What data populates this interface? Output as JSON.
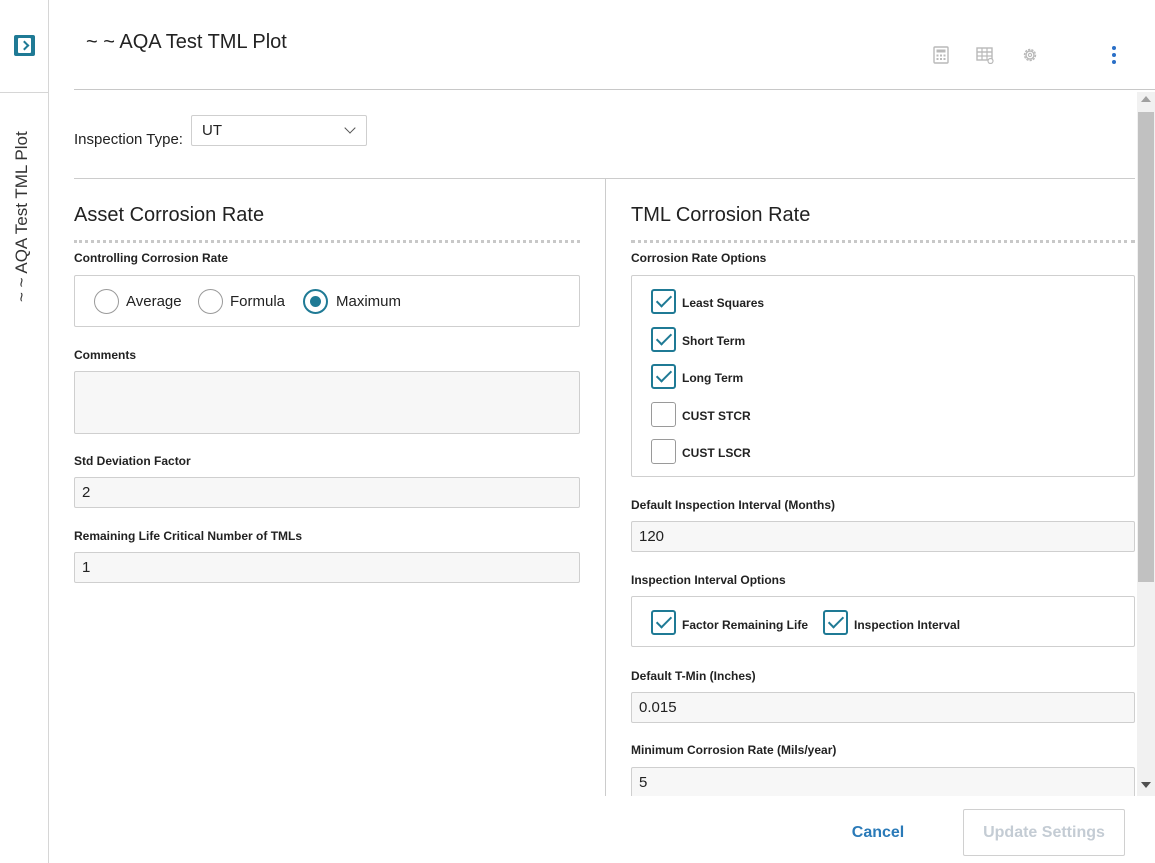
{
  "rail": {
    "title": "~ ~ AQA Test TML Plot"
  },
  "header": {
    "title": "~ ~ AQA Test TML Plot",
    "icons": [
      "calculator-icon",
      "table-settings-icon",
      "gear-icon",
      "more-vertical-icon"
    ]
  },
  "inspection_type": {
    "label": "Inspection Type:",
    "value": "UT"
  },
  "asset": {
    "title": "Asset Corrosion Rate",
    "controlling_label": "Controlling Corrosion Rate",
    "radios": [
      {
        "label": "Average",
        "selected": false
      },
      {
        "label": "Formula",
        "selected": false
      },
      {
        "label": "Maximum",
        "selected": true
      }
    ],
    "comments_label": "Comments",
    "comments_value": "",
    "std_dev_label": "Std Deviation Factor",
    "std_dev_value": "2",
    "remaining_life_label": "Remaining Life Critical Number of TMLs",
    "remaining_life_value": "1"
  },
  "tml": {
    "title": "TML Corrosion Rate",
    "options_label": "Corrosion Rate Options",
    "options": [
      {
        "label": "Least Squares",
        "checked": true
      },
      {
        "label": "Short Term",
        "checked": true
      },
      {
        "label": "Long Term",
        "checked": true
      },
      {
        "label": "CUST STCR",
        "checked": false
      },
      {
        "label": "CUST LSCR",
        "checked": false
      }
    ],
    "default_interval_label": "Default Inspection Interval (Months)",
    "default_interval_value": "120",
    "interval_options_label": "Inspection Interval Options",
    "interval_options": [
      {
        "label": "Factor Remaining Life",
        "checked": true
      },
      {
        "label": "Inspection Interval",
        "checked": true
      }
    ],
    "tmin_label": "Default T-Min (Inches)",
    "tmin_value": "0.015",
    "min_rate_label": "Minimum Corrosion Rate (Mils/year)",
    "min_rate_value": "5"
  },
  "footer": {
    "cancel_label": "Cancel",
    "update_label": "Update Settings"
  },
  "colors": {
    "accent": "#1f7a95",
    "link": "#2a7ab8",
    "disabled_text": "#c4ccd4",
    "border": "#cfcfcf"
  }
}
